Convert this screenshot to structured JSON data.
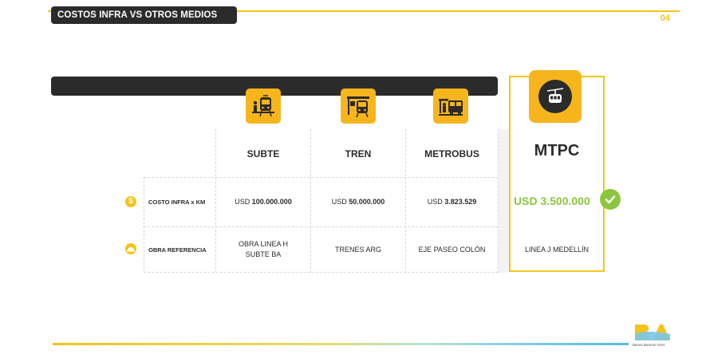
{
  "header": {
    "title": "COSTOS INFRA VS OTROS MEDIOS",
    "page_number": "04"
  },
  "columns": [
    {
      "key": "subte",
      "label": "SUBTE",
      "icon": "subway-icon"
    },
    {
      "key": "tren",
      "label": "TREN",
      "icon": "train-icon"
    },
    {
      "key": "metrobus",
      "label": "METROBUS",
      "icon": "bus-icon"
    },
    {
      "key": "mtpc",
      "label": "MTPC",
      "icon": "cable-car-icon"
    }
  ],
  "rows": {
    "costo": {
      "label": "COSTO INFRA x KM",
      "icon": "dollar-icon",
      "currency": "USD",
      "subte": "100.000.000",
      "tren": "50.000.000",
      "metrobus": "3.823.529",
      "mtpc": "USD 3.500.000"
    },
    "obra": {
      "label": "OBRA REFERENCIA",
      "icon": "hard-hat-icon",
      "subte_line1": "OBRA LINEA H",
      "subte_line2": "SUBTE BA",
      "tren": "TRENES ARG",
      "metrobus": "EJE PASEO COLÓN",
      "mtpc": "LINEA J MEDELLÍN"
    }
  },
  "footer": {
    "logo_text": "BA",
    "tagline": "Vamos Buenos Aires"
  },
  "colors": {
    "accent": "#f5c31a",
    "icon_bg": "#f7b51d",
    "dark": "#2b2b2b",
    "highlight_green": "#8cc63f"
  }
}
